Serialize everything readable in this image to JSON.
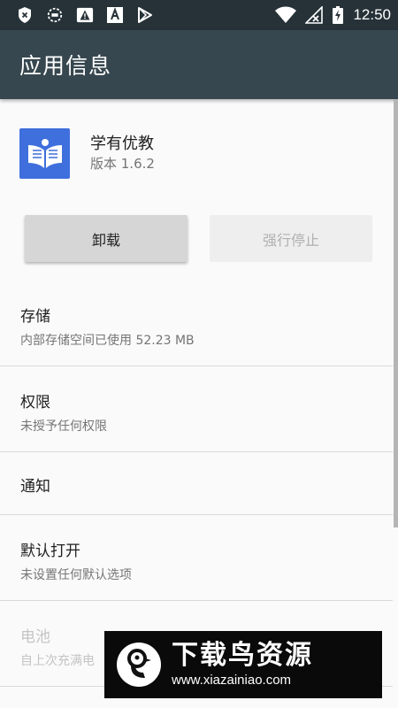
{
  "status_bar": {
    "time": "12:50",
    "icons_left": [
      "shield-x-icon",
      "dotted-circle-icon",
      "alert-triangle-icon",
      "a-box-icon",
      "play-store-icon"
    ],
    "icons_right": [
      "wifi-icon",
      "no-signal-icon",
      "battery-charging-icon"
    ]
  },
  "app_bar": {
    "title": "应用信息"
  },
  "app": {
    "name": "学有优教",
    "version": "版本 1.6.2"
  },
  "buttons": {
    "uninstall": "卸载",
    "force_stop": "强行停止"
  },
  "rows": [
    {
      "title": "存储",
      "subtitle": "内部存储空间已使用 52.23 MB"
    },
    {
      "title": "权限",
      "subtitle": "未授予任何权限"
    },
    {
      "title": "通知"
    },
    {
      "title": "默认打开",
      "subtitle": "未设置任何默认选项"
    },
    {
      "title": "电池",
      "subtitle": "自上次充满电"
    }
  ],
  "watermark": {
    "name": "下载鸟资源",
    "url": "www.xiazainiao.com"
  },
  "colors": {
    "status_bar": "#263238",
    "app_bar": "#37474f",
    "app_icon": "#3f6fdc"
  }
}
